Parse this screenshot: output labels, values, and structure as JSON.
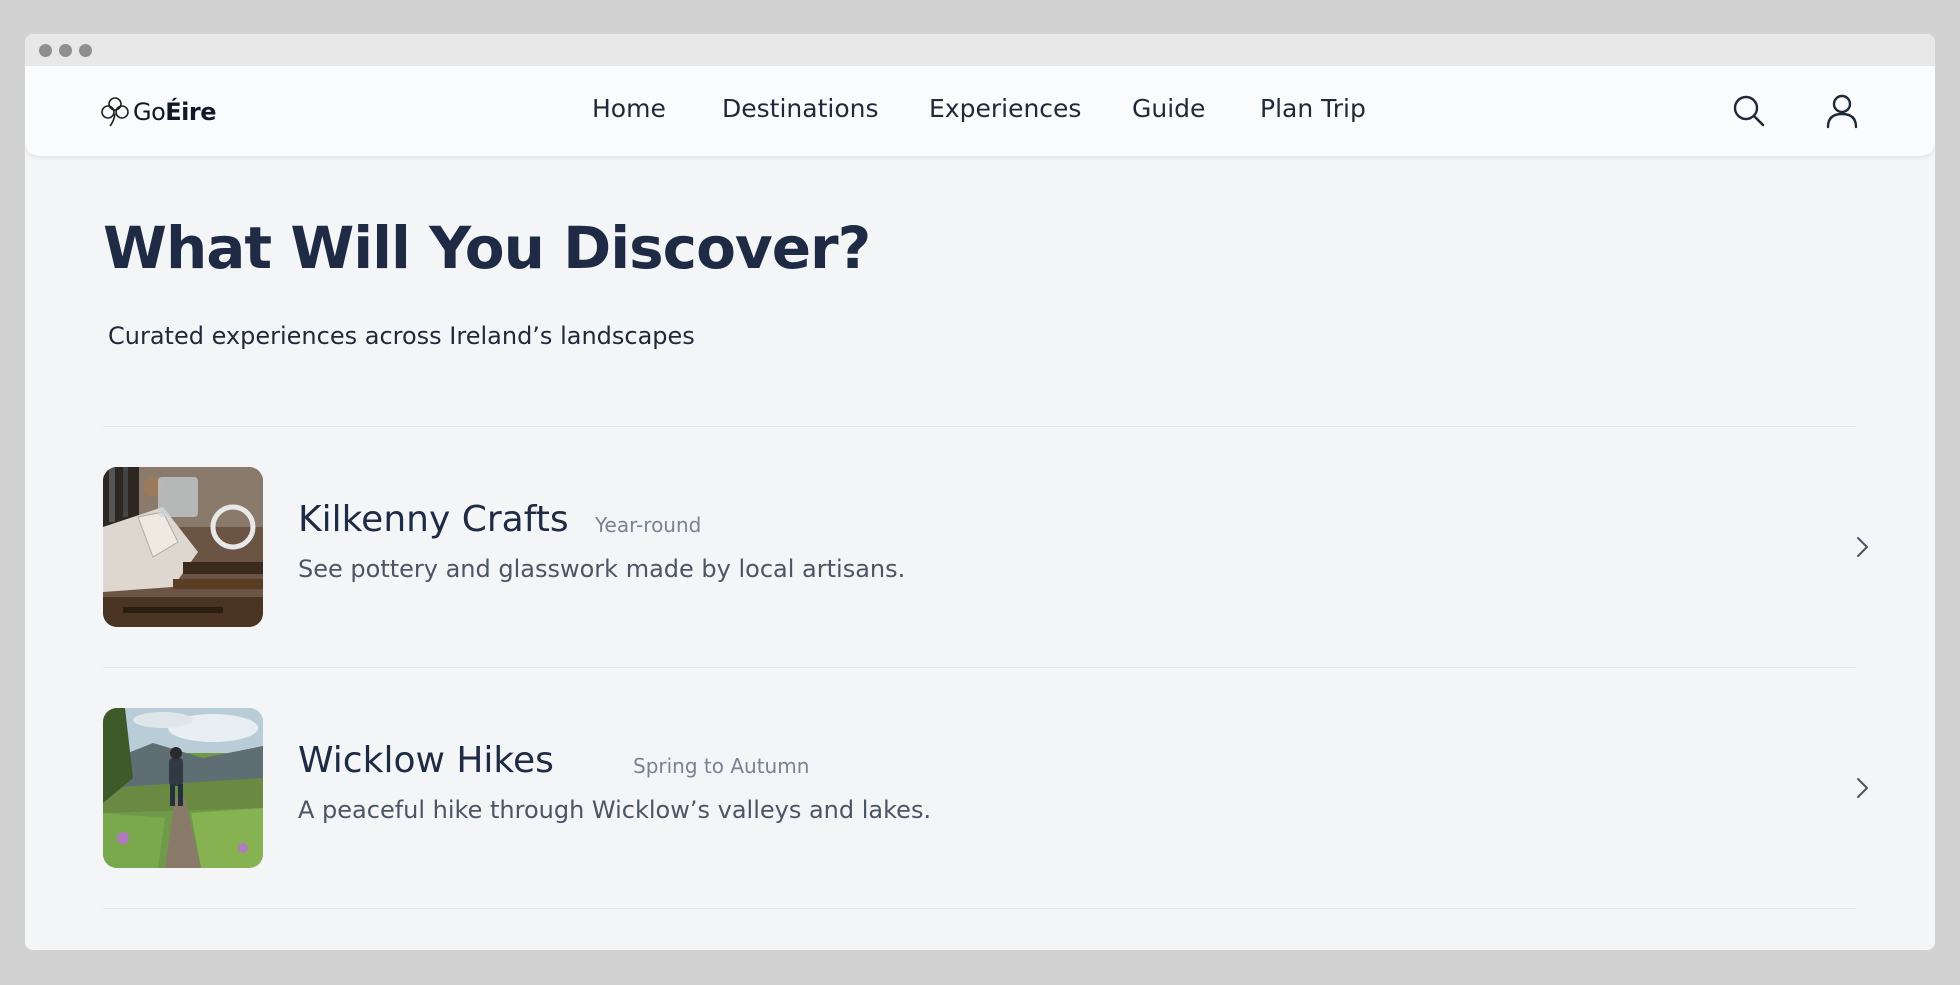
{
  "brand": {
    "prefix": "Go",
    "suffix": "Éire"
  },
  "nav": {
    "items": [
      {
        "label": "Home"
      },
      {
        "label": "Destinations"
      },
      {
        "label": "Experiences"
      },
      {
        "label": "Guide"
      },
      {
        "label": "Plan Trip"
      }
    ],
    "icons": [
      "search-icon",
      "user-icon"
    ]
  },
  "hero": {
    "title": "What Will You Discover?",
    "subtitle": "Curated experiences across Ireland’s landscapes"
  },
  "experiences": [
    {
      "title": "Kilkenny Crafts",
      "badge": "Year-round",
      "description": "See pottery and glasswork made by local artisans.",
      "thumbnail_icon": "crafts-thumbnail"
    },
    {
      "title": "Wicklow Hikes",
      "badge": "Spring to Autumn",
      "description": "A peaceful hike through Wicklow’s valleys and lakes.",
      "thumbnail_icon": "hike-thumbnail"
    }
  ],
  "colors": {
    "heading": "#1f2a44",
    "muted": "#7a8290",
    "background": "#f4f5f7"
  }
}
